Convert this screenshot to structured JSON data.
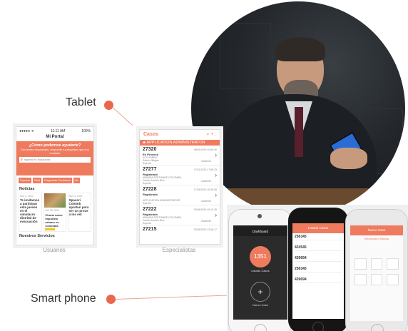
{
  "labels": {
    "tablet": "Tablet",
    "smartphone": "Smart phone",
    "usuarios": "Usuarios",
    "especialistas": "Especialistas"
  },
  "colors": {
    "accent": "#ef7b5f",
    "dot": "#e8684b"
  },
  "usuarios_screen": {
    "status_time": "11:11 AM",
    "status_battery": "100%",
    "title": "Mi Portal",
    "question": "¿Cómo podemos ayudarte?",
    "subtitle": "Encuentra respuestas, responde a preguntas que nos enviaste",
    "search_placeholder": "Ingresa tu búsqueda",
    "chips": [
      "Soporte",
      "FAQ",
      "Preguntas Comunes",
      "Ca"
    ],
    "news_title": "Noticias",
    "news": [
      {
        "date": "Nov 4, 2021",
        "text": "Te invitamos a participar este jueves en el simulacro distrital de evacuación"
      },
      {
        "date": "Oct 28, 2021",
        "text": "Charla sobre impuesto urbano en Colombia"
      },
      {
        "date": "Nov 4, 2021",
        "text": "Spaceri Colomb oportun para ser un proce a los est"
      }
    ],
    "services_title": "Nuestros Servicios"
  },
  "especialistas_screen": {
    "title": "Casos",
    "group": "APPLICATION ADMINISTRATOR",
    "cases": [
      {
        "id": "27320",
        "date": "08/01/2019 10:50:40",
        "status": "En Proceso",
        "line1": "XCO FABRIC",
        "line2": "Edwin Villegas",
        "line3": "Soporte",
        "tag": "Incidente"
      },
      {
        "id": "27277",
        "date": "07/11/2019 17:56:33",
        "status": "Registrado",
        "line1": "ARANDA SOFTWARE COLOMBIA",
        "line2": "Camilo Andrés Ruiz",
        "line3": "Soporte",
        "tag": "Incidente"
      },
      {
        "id": "27228",
        "date": "17/06/2019 16:30:36",
        "status": "Registrado",
        "line1": "APPLICATION ADMINISTRATOR",
        "line2": "",
        "line3": "Soporte",
        "tag": "Incidente"
      },
      {
        "id": "27222",
        "date": "05/06/2019 15:12:35",
        "status": "Registrado",
        "line1": "ARANDA SOFTWARE COLOMBIA",
        "line2": "Camilo Andrés Ruiz",
        "line3": "Soporte",
        "tag": "Incidente"
      },
      {
        "id": "27215",
        "date": "03/06/2019 13:46:17",
        "status": "",
        "line1": "",
        "line2": "",
        "line3": "",
        "tag": ""
      }
    ]
  },
  "phone1": {
    "header": "Dashboard",
    "count": "1351",
    "count_label": "Listado Casos",
    "new_label": "Nuevo Caso"
  },
  "phone2": {
    "header": "Listado Casos",
    "ids": [
      "256345",
      "424545",
      "439694",
      "256345",
      "439694"
    ]
  },
  "phone3": {
    "header": "Nuevo Caso",
    "sub": "Información Básica"
  }
}
